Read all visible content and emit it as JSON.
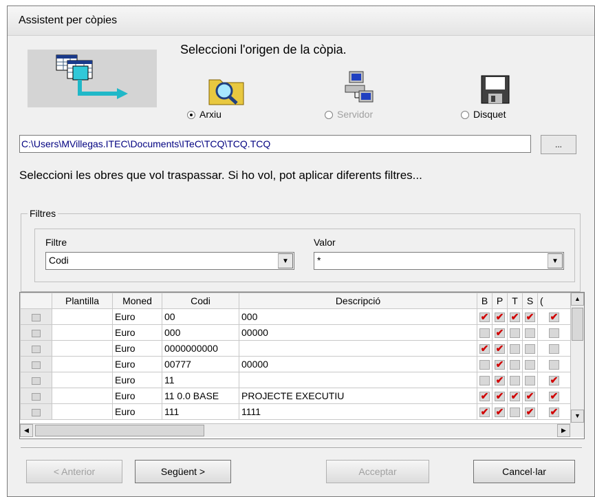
{
  "window": {
    "title": "Assistent per còpies"
  },
  "source": {
    "heading": "Seleccioni l'origen de la còpia.",
    "options": [
      {
        "label": "Arxiu",
        "selected": true,
        "enabled": true,
        "icon": "folder-search-icon"
      },
      {
        "label": "Servidor",
        "selected": false,
        "enabled": false,
        "icon": "network-computers-icon"
      },
      {
        "label": "Disquet",
        "selected": false,
        "enabled": true,
        "icon": "floppy-disk-icon"
      }
    ],
    "path": "C:\\Users\\MVillegas.ITEC\\Documents\\ITeC\\TCQ\\TCQ.TCQ",
    "browse_label": "..."
  },
  "instructions": "Seleccioni les obres que vol traspassar. Si ho vol, pot aplicar diferents filtres...",
  "filters": {
    "group_label": "Filtres",
    "filter_label": "Filtre",
    "filter_value": "Codi",
    "value_label": "Valor",
    "value_value": "*"
  },
  "grid": {
    "columns": [
      "",
      "Plantilla",
      "Moned",
      "Codi",
      "Descripció",
      "B",
      "P",
      "T",
      "S",
      "("
    ],
    "rows": [
      {
        "plantilla": "",
        "moneda": "Euro",
        "codi": "00",
        "descripcio": "000",
        "flags": [
          true,
          true,
          true,
          true,
          true
        ]
      },
      {
        "plantilla": "",
        "moneda": "Euro",
        "codi": "000",
        "descripcio": "00000",
        "flags": [
          false,
          true,
          false,
          false,
          false
        ]
      },
      {
        "plantilla": "",
        "moneda": "Euro",
        "codi": "0000000000",
        "descripcio": "",
        "flags": [
          true,
          true,
          false,
          false,
          false
        ]
      },
      {
        "plantilla": "",
        "moneda": "Euro",
        "codi": "00777",
        "descripcio": "00000",
        "flags": [
          false,
          true,
          false,
          false,
          false
        ]
      },
      {
        "plantilla": "",
        "moneda": "Euro",
        "codi": "11",
        "descripcio": "",
        "flags": [
          false,
          true,
          false,
          false,
          true
        ]
      },
      {
        "plantilla": "",
        "moneda": "Euro",
        "codi": "11 0.0 BASE",
        "descripcio": "PROJECTE EXECUTIU",
        "flags": [
          true,
          true,
          true,
          true,
          true
        ]
      },
      {
        "plantilla": "",
        "moneda": "Euro",
        "codi": "111",
        "descripcio": "1111",
        "flags": [
          true,
          true,
          false,
          true,
          true
        ]
      }
    ]
  },
  "buttons": {
    "back": "< Anterior",
    "next": "Següent >",
    "accept": "Acceptar",
    "cancel": "Cancel·lar"
  }
}
